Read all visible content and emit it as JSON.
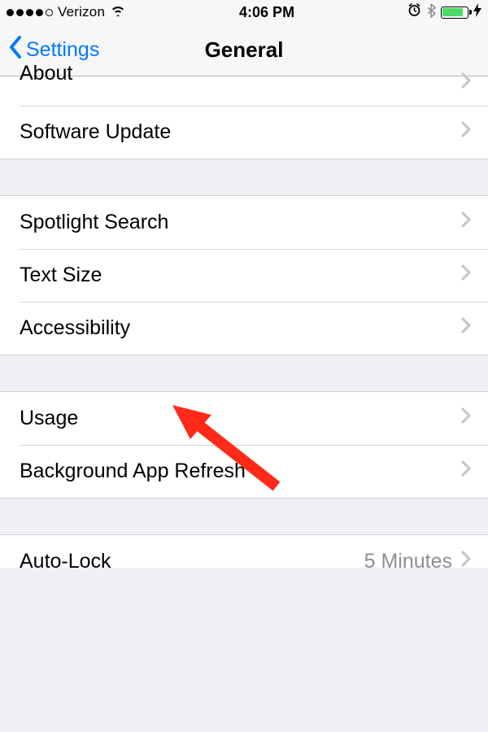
{
  "status": {
    "carrier": "Verizon",
    "time": "4:06 PM"
  },
  "nav": {
    "back_label": "Settings",
    "title": "General"
  },
  "rows": {
    "about": "About",
    "software_update": "Software Update",
    "spotlight_search": "Spotlight Search",
    "text_size": "Text Size",
    "accessibility": "Accessibility",
    "usage": "Usage",
    "background_app_refresh": "Background App Refresh",
    "auto_lock": "Auto-Lock",
    "auto_lock_value": "5 Minutes"
  }
}
